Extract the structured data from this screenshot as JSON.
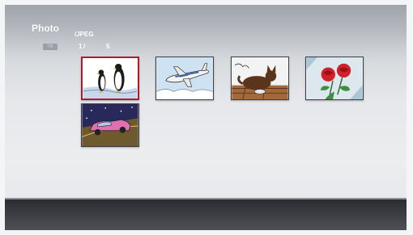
{
  "header": {
    "title": "Photo",
    "badge": "TR",
    "folder": "/JPEG",
    "page_current": "1",
    "page_separator": "/",
    "page_total": "5"
  },
  "thumbnails": [
    {
      "name": "penguins",
      "selected": true
    },
    {
      "name": "airplane",
      "selected": false
    },
    {
      "name": "cat",
      "selected": false
    },
    {
      "name": "roses",
      "selected": false
    },
    {
      "name": "car",
      "selected": false
    }
  ],
  "colors": {
    "selection": "#b01a2a",
    "bottom_bar": "#2c2d31"
  }
}
